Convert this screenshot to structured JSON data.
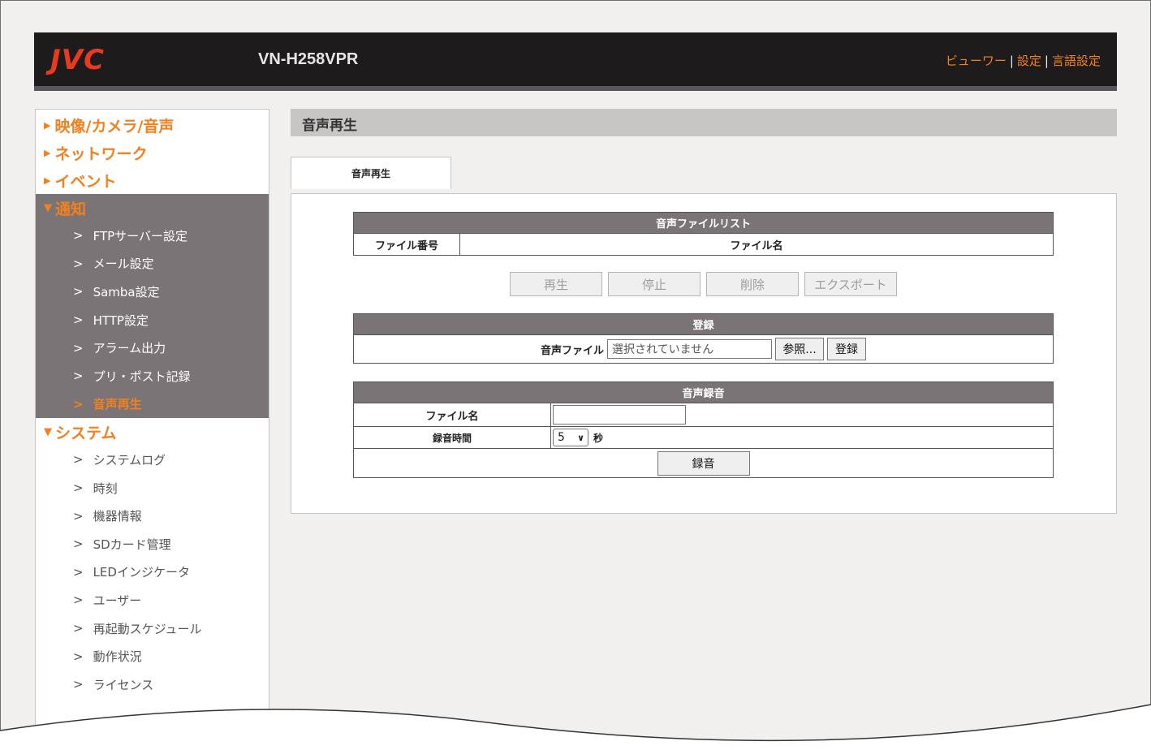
{
  "header": {
    "logo": "JVC",
    "model": "VN-H258VPR",
    "links": [
      "ビューワー",
      "設定",
      "言語設定"
    ]
  },
  "sidebar": {
    "cat_video": "映像/カメラ/音声",
    "cat_network": "ネットワーク",
    "cat_event": "イベント",
    "cat_notify": "通知",
    "notify_items": [
      "FTPサーバー設定",
      "メール設定",
      "Samba設定",
      "HTTP設定",
      "アラーム出力",
      "プリ・ポスト記録",
      "音声再生"
    ],
    "cat_system": "システム",
    "system_items": [
      "システムログ",
      "時刻",
      "機器情報",
      "SDカード管理",
      "LEDインジケータ",
      "ユーザー",
      "再起動スケジュール",
      "動作状況",
      "ライセンス"
    ]
  },
  "main": {
    "title": "音声再生",
    "tab": "音声再生",
    "filelist": {
      "header": "音声ファイルリスト",
      "col_number": "ファイル番号",
      "col_name": "ファイル名"
    },
    "buttons": {
      "play": "再生",
      "stop": "停止",
      "delete": "削除",
      "export": "エクスポート"
    },
    "register": {
      "header": "登録",
      "label": "音声ファイル",
      "file_placeholder": "選択されていません",
      "browse": "参照...",
      "register": "登録"
    },
    "record": {
      "header": "音声録音",
      "filename_label": "ファイル名",
      "filename_value": "",
      "duration_label": "録音時間",
      "duration_value": "5",
      "unit": "秒",
      "record_button": "録音"
    }
  }
}
